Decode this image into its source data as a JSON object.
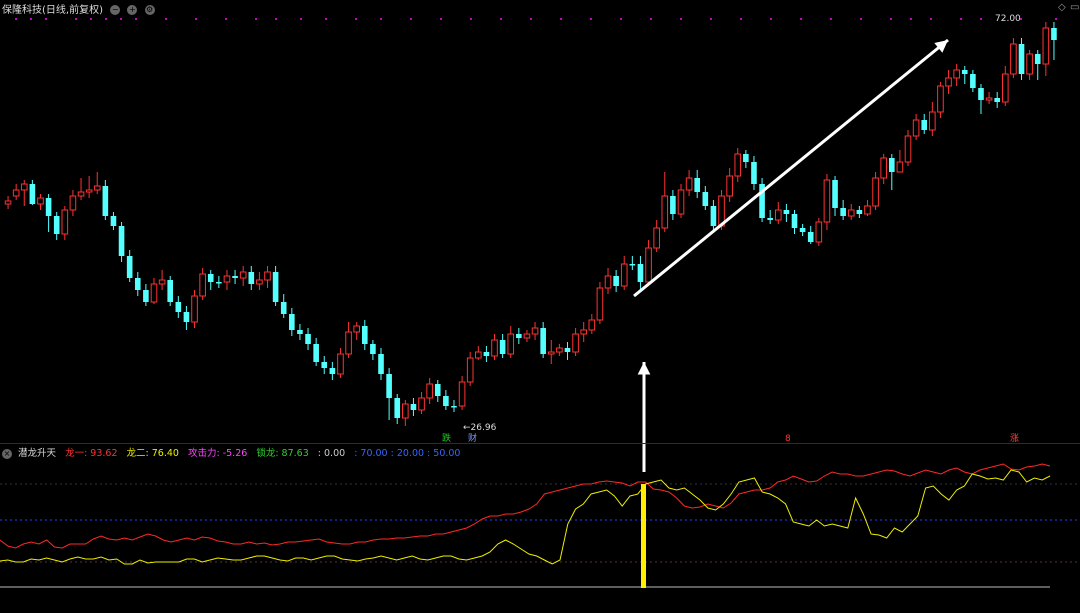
{
  "main": {
    "title": "保隆科技(日线,前复权)",
    "max_label": "72.00",
    "min_label": "26.96",
    "markers": [
      {
        "text": "跌",
        "color": "#22cc22"
      },
      {
        "text": "财",
        "color": "#7799ff"
      },
      {
        "text": "8",
        "color": "#ff3333"
      },
      {
        "text": "涨",
        "color": "#ff4444"
      }
    ],
    "colors": {
      "up": "#ff3232",
      "down": "#54ffff",
      "arrow": "#ffffff",
      "purple_dot": "#cc00cc"
    },
    "candles": [
      [
        204,
        201,
        196,
        209
      ],
      [
        196,
        190,
        184,
        200
      ],
      [
        190,
        184,
        180,
        206
      ],
      [
        184,
        204,
        180,
        205
      ],
      [
        204,
        198,
        194,
        210
      ],
      [
        198,
        216,
        194,
        232
      ],
      [
        216,
        234,
        212,
        240
      ],
      [
        234,
        210,
        206,
        240
      ],
      [
        210,
        196,
        190,
        216
      ],
      [
        196,
        192,
        178,
        200
      ],
      [
        192,
        190,
        176,
        198
      ],
      [
        190,
        186,
        172,
        194
      ],
      [
        186,
        216,
        180,
        220
      ],
      [
        216,
        226,
        212,
        230
      ],
      [
        226,
        256,
        222,
        262
      ],
      [
        256,
        278,
        250,
        282
      ],
      [
        278,
        290,
        272,
        296
      ],
      [
        290,
        302,
        284,
        306
      ],
      [
        302,
        284,
        278,
        304
      ],
      [
        284,
        280,
        270,
        290
      ],
      [
        280,
        302,
        276,
        306
      ],
      [
        302,
        312,
        296,
        318
      ],
      [
        312,
        322,
        306,
        330
      ],
      [
        322,
        296,
        290,
        328
      ],
      [
        296,
        274,
        268,
        300
      ],
      [
        274,
        282,
        270,
        290
      ],
      [
        282,
        282,
        276,
        288
      ],
      [
        282,
        276,
        270,
        290
      ],
      [
        276,
        278,
        270,
        284
      ],
      [
        278,
        272,
        266,
        286
      ],
      [
        272,
        284,
        266,
        290
      ],
      [
        284,
        280,
        272,
        290
      ],
      [
        280,
        272,
        266,
        288
      ],
      [
        272,
        302,
        266,
        306
      ],
      [
        302,
        314,
        294,
        318
      ],
      [
        314,
        330,
        308,
        336
      ],
      [
        330,
        334,
        324,
        340
      ],
      [
        334,
        344,
        328,
        350
      ],
      [
        344,
        362,
        338,
        366
      ],
      [
        362,
        368,
        356,
        374
      ],
      [
        368,
        374,
        362,
        380
      ],
      [
        374,
        354,
        348,
        378
      ],
      [
        354,
        332,
        322,
        358
      ],
      [
        332,
        326,
        322,
        340
      ],
      [
        326,
        344,
        320,
        350
      ],
      [
        344,
        354,
        340,
        360
      ],
      [
        354,
        374,
        348,
        380
      ],
      [
        374,
        398,
        368,
        420
      ],
      [
        398,
        418,
        394,
        424
      ],
      [
        418,
        404,
        400,
        426
      ],
      [
        404,
        410,
        398,
        416
      ],
      [
        410,
        398,
        392,
        414
      ],
      [
        398,
        384,
        378,
        404
      ],
      [
        384,
        396,
        380,
        402
      ],
      [
        396,
        406,
        390,
        410
      ],
      [
        406,
        406,
        400,
        412
      ],
      [
        406,
        382,
        376,
        410
      ],
      [
        382,
        358,
        352,
        386
      ],
      [
        358,
        352,
        346,
        360
      ],
      [
        352,
        356,
        346,
        362
      ],
      [
        356,
        340,
        334,
        360
      ],
      [
        340,
        354,
        334,
        358
      ],
      [
        354,
        334,
        326,
        358
      ],
      [
        334,
        338,
        328,
        344
      ],
      [
        338,
        334,
        330,
        342
      ],
      [
        334,
        328,
        322,
        340
      ],
      [
        328,
        354,
        322,
        358
      ],
      [
        354,
        352,
        340,
        364
      ],
      [
        352,
        348,
        344,
        356
      ],
      [
        348,
        352,
        342,
        360
      ],
      [
        352,
        334,
        328,
        356
      ],
      [
        334,
        330,
        322,
        342
      ],
      [
        330,
        320,
        314,
        334
      ],
      [
        320,
        288,
        282,
        324
      ],
      [
        288,
        276,
        268,
        294
      ],
      [
        276,
        286,
        270,
        292
      ],
      [
        286,
        264,
        256,
        290
      ],
      [
        264,
        264,
        256,
        270
      ],
      [
        264,
        282,
        256,
        290
      ],
      [
        282,
        248,
        240,
        284
      ],
      [
        248,
        228,
        220,
        252
      ],
      [
        228,
        196,
        172,
        232
      ],
      [
        196,
        214,
        190,
        220
      ],
      [
        214,
        190,
        184,
        218
      ],
      [
        190,
        178,
        170,
        196
      ],
      [
        178,
        192,
        170,
        198
      ],
      [
        192,
        206,
        186,
        210
      ],
      [
        206,
        226,
        200,
        232
      ],
      [
        226,
        196,
        190,
        230
      ],
      [
        196,
        176,
        168,
        202
      ],
      [
        176,
        154,
        148,
        182
      ],
      [
        154,
        162,
        150,
        168
      ],
      [
        162,
        184,
        156,
        190
      ],
      [
        184,
        218,
        178,
        222
      ],
      [
        218,
        220,
        210,
        224
      ],
      [
        220,
        210,
        202,
        224
      ],
      [
        210,
        214,
        204,
        222
      ],
      [
        214,
        228,
        210,
        234
      ],
      [
        228,
        232,
        224,
        236
      ],
      [
        232,
        242,
        226,
        244
      ],
      [
        242,
        222,
        218,
        246
      ],
      [
        222,
        180,
        174,
        230
      ],
      [
        180,
        208,
        176,
        216
      ],
      [
        208,
        216,
        200,
        220
      ],
      [
        216,
        210,
        204,
        220
      ],
      [
        210,
        214,
        206,
        218
      ],
      [
        214,
        206,
        200,
        216
      ],
      [
        206,
        178,
        172,
        210
      ],
      [
        178,
        158,
        154,
        184
      ],
      [
        158,
        172,
        154,
        190
      ],
      [
        172,
        162,
        150,
        170
      ],
      [
        162,
        136,
        130,
        166
      ],
      [
        136,
        120,
        114,
        140
      ],
      [
        120,
        130,
        114,
        134
      ],
      [
        130,
        112,
        102,
        136
      ],
      [
        112,
        86,
        82,
        118
      ],
      [
        86,
        78,
        70,
        94
      ],
      [
        78,
        70,
        64,
        86
      ],
      [
        70,
        74,
        66,
        84
      ],
      [
        74,
        88,
        70,
        92
      ],
      [
        88,
        100,
        84,
        114
      ],
      [
        100,
        98,
        92,
        104
      ],
      [
        98,
        102,
        92,
        108
      ],
      [
        102,
        74,
        66,
        106
      ],
      [
        74,
        44,
        38,
        78
      ],
      [
        44,
        74,
        38,
        80
      ],
      [
        74,
        54,
        50,
        80
      ],
      [
        54,
        64,
        50,
        80
      ],
      [
        64,
        28,
        22,
        76
      ],
      [
        28,
        40,
        22,
        60
      ]
    ],
    "purple_dots": [
      15,
      30,
      45,
      75,
      90,
      105,
      120,
      135,
      165,
      195,
      225,
      255,
      275,
      300,
      325,
      355,
      380,
      410,
      440,
      470,
      500,
      530,
      560,
      590,
      620,
      650,
      680,
      710,
      740,
      770,
      800,
      830,
      860,
      890,
      910,
      930,
      960,
      980,
      1020,
      1055
    ]
  },
  "indicator": {
    "name": "潜龙升天",
    "legend": [
      {
        "text": "龙一: 93.62",
        "color": "#ff3333"
      },
      {
        "text": "龙二: 76.40",
        "color": "#eeee00"
      },
      {
        "text": "攻击力: -5.26",
        "color": "#ff44ff"
      },
      {
        "text": "锁龙: 87.63",
        "color": "#33cc33"
      },
      {
        "text": ": 0.00",
        "color": "#cccccc"
      },
      {
        "text": ": 70.00 : 20.00 : 50.00",
        "color": "#3366ff"
      }
    ],
    "dragon_one": [
      76,
      82,
      84,
      80,
      78,
      80,
      76,
      83,
      84,
      80,
      80,
      80,
      75,
      72,
      75,
      76,
      74,
      76,
      73,
      70,
      72,
      76,
      78,
      76,
      74,
      76,
      73,
      74,
      77,
      78,
      80,
      80,
      78,
      80,
      79,
      81,
      80,
      78,
      78,
      77,
      76,
      75,
      78,
      79,
      80,
      80,
      78,
      78,
      76,
      75,
      75,
      74,
      74,
      73,
      72,
      72,
      70,
      70,
      68,
      66,
      64,
      60,
      55,
      52,
      52,
      50,
      50,
      48,
      45,
      40,
      30,
      28,
      26,
      24,
      22,
      20,
      20,
      18,
      17,
      18,
      19,
      22,
      18,
      18,
      25,
      26,
      28,
      34,
      42,
      44,
      43,
      40,
      42,
      44,
      39,
      30,
      28,
      26,
      26,
      24,
      18,
      16,
      12,
      15,
      18,
      17,
      12,
      8,
      10,
      10,
      12,
      12,
      10,
      8,
      6,
      7,
      10,
      12,
      9,
      6,
      8,
      10,
      6,
      4,
      8,
      10,
      6,
      4,
      2,
      0,
      5,
      6,
      3,
      2,
      0,
      2
    ],
    "dragon_two": [
      97,
      96,
      98,
      98,
      95,
      96,
      94,
      96,
      98,
      95,
      93,
      95,
      95,
      93,
      96,
      95,
      100,
      100,
      96,
      99,
      98,
      98,
      98,
      98,
      95,
      95,
      98,
      96,
      94,
      95,
      96,
      96,
      94,
      92,
      92,
      94,
      96,
      97,
      94,
      94,
      96,
      94,
      92,
      92,
      95,
      96,
      97,
      95,
      94,
      92,
      94,
      96,
      94,
      92,
      95,
      96,
      94,
      92,
      92,
      95,
      96,
      94,
      92,
      88,
      80,
      76,
      80,
      85,
      90,
      92,
      96,
      100,
      96,
      60,
      45,
      40,
      30,
      28,
      26,
      32,
      42,
      32,
      30,
      20,
      18,
      16,
      24,
      26,
      24,
      30,
      36,
      44,
      46,
      40,
      30,
      18,
      16,
      14,
      28,
      30,
      34,
      40,
      58,
      60,
      62,
      56,
      62,
      60,
      62,
      64,
      34,
      50,
      70,
      71,
      74,
      64,
      68,
      60,
      52,
      24,
      22,
      30,
      36,
      26,
      22,
      10,
      12,
      15,
      14,
      16,
      6,
      8,
      18,
      14,
      16,
      12
    ],
    "colors": {
      "dragon_one": "#ff2828",
      "dragon_two": "#eeee00",
      "signal": "#ffee00"
    }
  }
}
